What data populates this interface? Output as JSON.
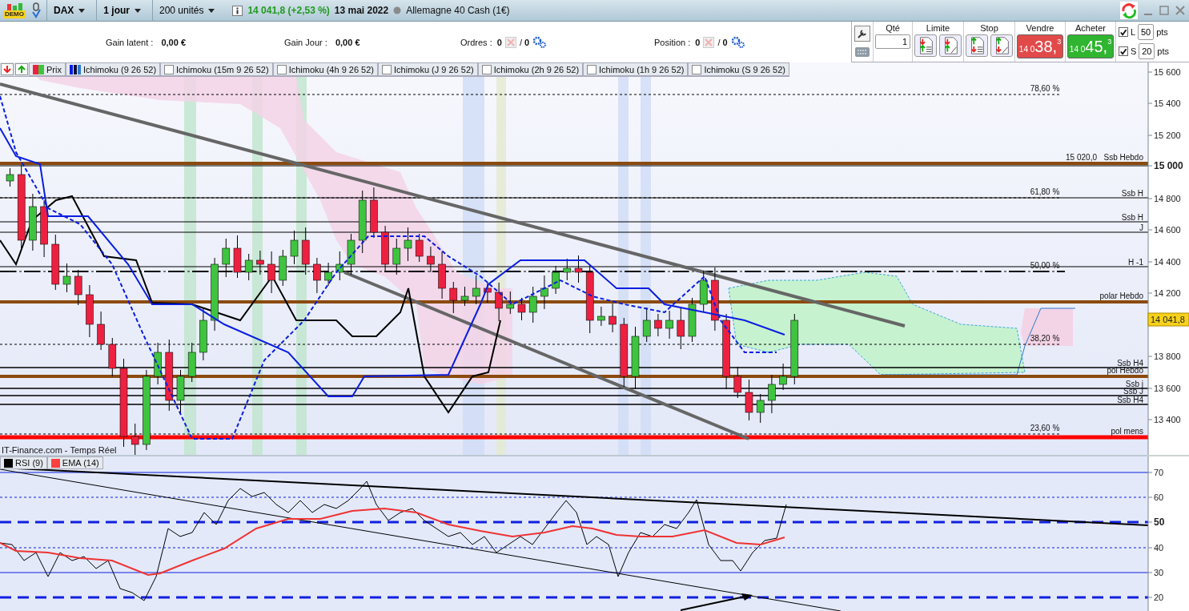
{
  "toolbar": {
    "logo_text": "DEMO",
    "dropdowns": [
      "DAX",
      "1 jour",
      "200 unités"
    ],
    "price": "14 041,8 (+2,53 %)",
    "date": "13 mai 2022",
    "instrument": "Allemagne 40 Cash (1€)"
  },
  "stats": [
    {
      "text": "Gain latent :  **0,00 €**"
    },
    {
      "text": "Gain Jour :  **0,00 €**"
    }
  ],
  "counters": [
    {
      "label": "Ordres :  **0**",
      "pending": "/ **0**"
    },
    {
      "label": "Position :  **0**",
      "pending": "/ **0**"
    }
  ],
  "trade_panel": {
    "qty_label": "Qté",
    "qty": "1",
    "limit_label": "Limite",
    "stop_label": "Stop",
    "sell": {
      "label": "Vendre",
      "prefix": "14 0",
      "big": "38,",
      "sup": "3"
    },
    "buy": {
      "label": "Acheter",
      "prefix": "14 0",
      "big": "45,",
      "sup": "3"
    },
    "offsets": [
      {
        "label": "L",
        "checked": true,
        "value": "50",
        "unit": "pts"
      },
      {
        "label": "S",
        "checked": true,
        "value": "20",
        "unit": "pts"
      }
    ]
  },
  "legend": [
    {
      "kind": "price",
      "label": "Prix"
    },
    {
      "kind": "line",
      "label": "Ichimoku (9 26 52)"
    },
    {
      "kind": "checkbox",
      "label": "Ichimoku (15m 9 26 52)",
      "checked": false
    },
    {
      "kind": "checkbox",
      "label": "Ichimoku (4h 9 26 52)",
      "checked": false
    },
    {
      "kind": "checkbox",
      "label": "Ichimoku (J 9 26 52)",
      "checked": false
    },
    {
      "kind": "checkbox",
      "label": "Ichimoku (2h 9 26 52)",
      "checked": false
    },
    {
      "kind": "checkbox",
      "label": "Ichimoku (1h 9 26 52)",
      "checked": false
    },
    {
      "kind": "checkbox",
      "label": "Ichimoku (S 9 26 52)",
      "checked": false
    }
  ],
  "price_chart": {
    "fib_labels": [
      "78,60 %",
      "61,80 %",
      "50,00 %",
      "38,20 %",
      "23,60 %"
    ],
    "levels": [
      {
        "label": "Ssb Hebdo",
        "value": "15 020,0",
        "kind": "brown"
      },
      {
        "label": "Ssb H",
        "kind": "thin"
      },
      {
        "label": "Ssb H",
        "kind": "thin"
      },
      {
        "label": "J",
        "kind": "thin"
      },
      {
        "label": "H -1",
        "kind": "thin"
      },
      {
        "label": "polar Hebdo",
        "kind": "brown"
      },
      {
        "label": "Ssb H4",
        "kind": "thin"
      },
      {
        "label": "pol Hebdo",
        "kind": "brown"
      },
      {
        "label": "Ssb j",
        "kind": "thin"
      },
      {
        "label": "Ssb J",
        "kind": "thin"
      },
      {
        "label": "Ssb H4",
        "kind": "thin"
      },
      {
        "label": "pol mens",
        "kind": "red"
      }
    ],
    "axis_ticks": [
      "15 600",
      "15 400",
      "15 200",
      "15 000",
      "14 800",
      "14 600",
      "14 400",
      "14 200",
      "13 800",
      "13 600",
      "13 400"
    ],
    "current_price": "14 041,8",
    "source": "IT-Finance.com - Temps Réel"
  },
  "rsi_panel": {
    "legend": [
      {
        "label": "RSI (9)",
        "color": "#000000"
      },
      {
        "label": "EMA (14)",
        "color": "#ff4040"
      }
    ],
    "axis_ticks": [
      "70",
      "60",
      "50",
      "40",
      "30",
      "20"
    ]
  }
}
